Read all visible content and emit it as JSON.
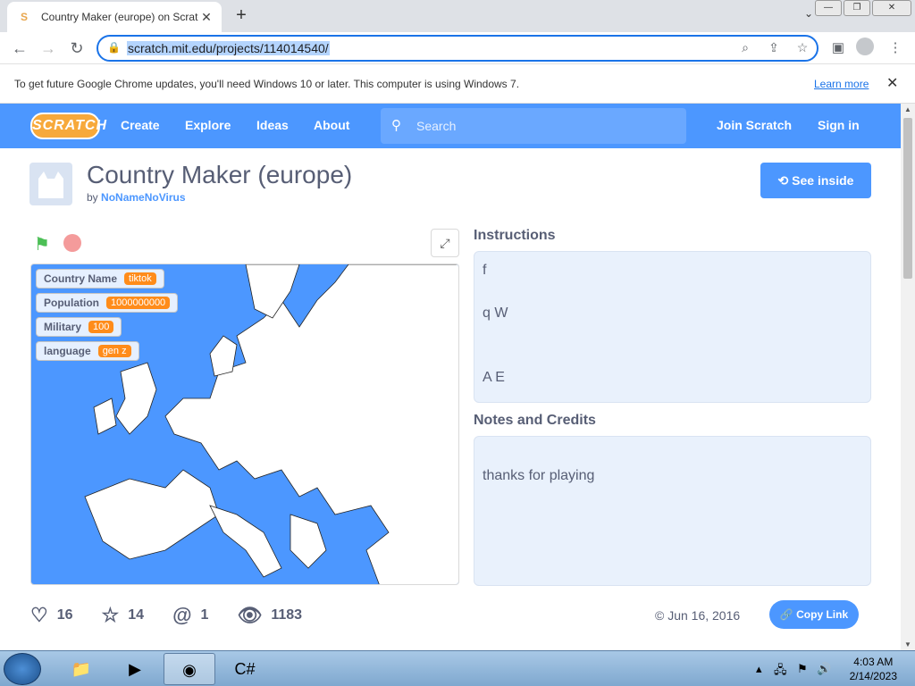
{
  "browser": {
    "tab_title": "Country Maker (europe) on Scratch",
    "tab_close": "✕",
    "new_tab": "+",
    "url": "scratch.mit.edu/projects/114014540/",
    "window_buttons": [
      "—",
      "❐",
      "✕"
    ]
  },
  "infobar": {
    "message": "To get future Google Chrome updates, you'll need Windows 10 or later. This computer is using Windows 7.",
    "learn_more": "Learn more",
    "close": "✕"
  },
  "scratch_nav": {
    "logo": "SCRATCH",
    "links": [
      "Create",
      "Explore",
      "Ideas",
      "About"
    ],
    "search_placeholder": "Search",
    "join": "Join Scratch",
    "signin": "Sign in"
  },
  "project": {
    "title": "Country Maker (europe)",
    "by_prefix": "by",
    "author": "NoNameNoVirus",
    "see_inside": "See inside"
  },
  "monitors": [
    {
      "label": "Country Name",
      "value": "tiktok"
    },
    {
      "label": "Population",
      "value": "1000000000"
    },
    {
      "label": "Military",
      "value": "100"
    },
    {
      "label": "language",
      "value": "gen z"
    }
  ],
  "instructions": {
    "heading": "Instructions",
    "lines": [
      "f",
      "q W",
      "A E"
    ]
  },
  "notes": {
    "heading": "Notes and Credits",
    "text": "thanks for playing"
  },
  "stats": {
    "loves": "16",
    "favorites": "14",
    "remixes": "1",
    "views": "1183"
  },
  "date": "© Jun 16, 2016",
  "copy_link": "Copy Link",
  "taskbar": {
    "time": "4:03 AM",
    "date": "2/14/2023"
  }
}
